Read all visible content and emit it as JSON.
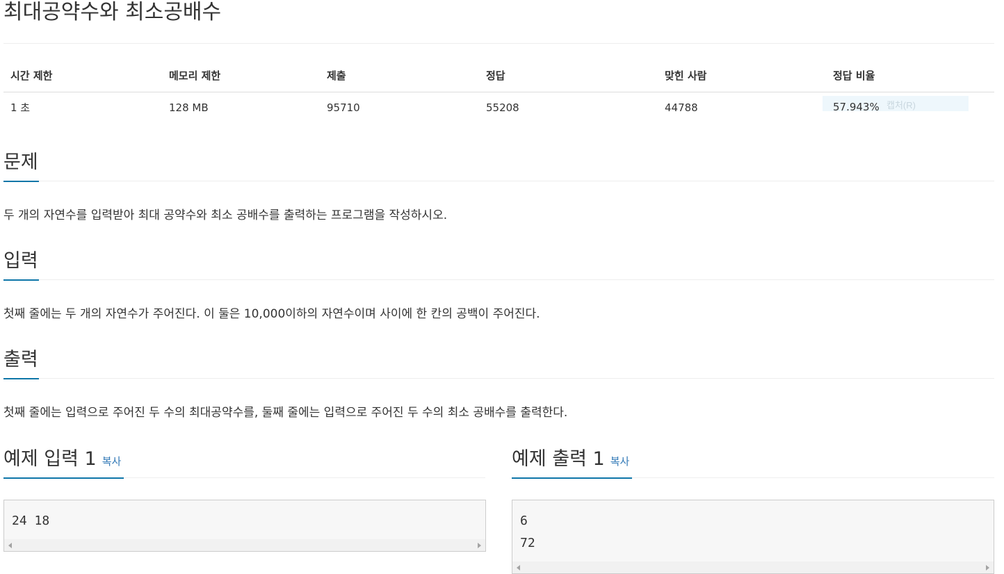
{
  "problem": {
    "title": "최대공약수와 최소공배수"
  },
  "stats": {
    "headers": [
      "시간 제한",
      "메모리 제한",
      "제출",
      "정답",
      "맞힌 사람",
      "정답 비율"
    ],
    "values": [
      "1 초",
      "128 MB",
      "95710",
      "55208",
      "44788",
      "57.943%"
    ],
    "overlay_text": "캡처(R)"
  },
  "sections": {
    "description": {
      "heading": "문제",
      "text": "두 개의 자연수를 입력받아 최대 공약수와 최소 공배수를 출력하는 프로그램을 작성하시오."
    },
    "input": {
      "heading": "입력",
      "text": "첫째 줄에는 두 개의 자연수가 주어진다. 이 둘은 10,000이하의 자연수이며 사이에 한 칸의 공백이 주어진다."
    },
    "output": {
      "heading": "출력",
      "text": "첫째 줄에는 입력으로 주어진 두 수의 최대공약수를, 둘째 줄에는 입력으로 주어진 두 수의 최소 공배수를 출력한다."
    }
  },
  "samples": {
    "input": {
      "heading": "예제 입력 1",
      "copy_label": "복사",
      "content": "24 18"
    },
    "output": {
      "heading": "예제 출력 1",
      "copy_label": "복사",
      "content": "6\n72"
    }
  },
  "colors": {
    "accent": "#0e76a8",
    "link": "#337ab7",
    "text": "#333333",
    "code_bg": "#f7f7f7"
  },
  "icons": [
    "scroll-left-arrow-icon",
    "scroll-right-arrow-icon"
  ]
}
